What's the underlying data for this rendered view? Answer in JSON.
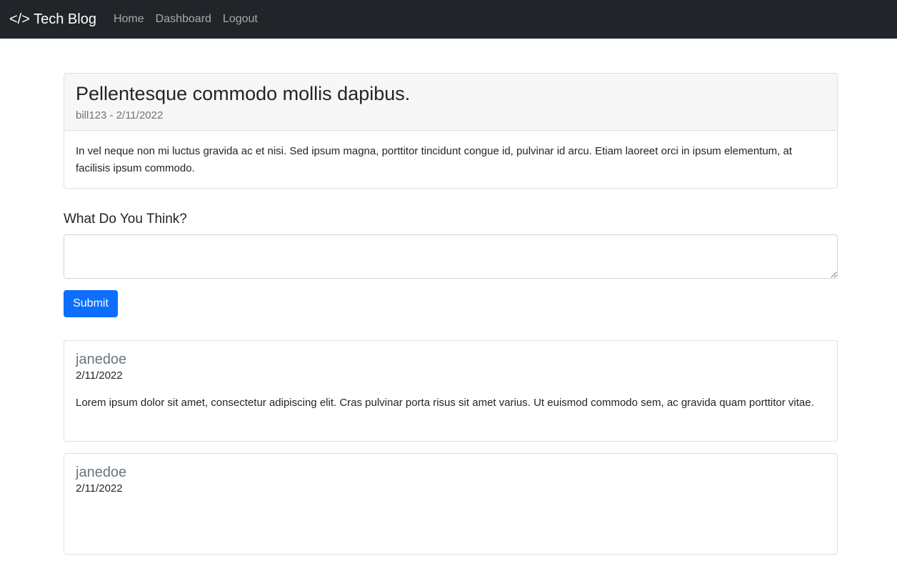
{
  "navbar": {
    "brand": "</> Tech Blog",
    "links": [
      "Home",
      "Dashboard",
      "Logout"
    ]
  },
  "post": {
    "title": "Pellentesque commodo mollis dapibus.",
    "meta": "bill123 - 2/11/2022",
    "body": "In vel neque non mi luctus gravida ac et nisi. Sed ipsum magna, porttitor tincidunt congue id, pulvinar id arcu. Etiam laoreet orci in ipsum elementum, at facilisis ipsum commodo."
  },
  "comment_form": {
    "label": "What Do You Think?",
    "value": "",
    "submit_label": "Submit"
  },
  "comments": [
    {
      "author": "janedoe",
      "date": "2/11/2022",
      "text": "Lorem ipsum dolor sit amet, consectetur adipiscing elit. Cras pulvinar porta risus sit amet varius. Ut euismod commodo sem, ac gravida quam porttitor vitae."
    },
    {
      "author": "janedoe",
      "date": "2/11/2022",
      "text": ""
    }
  ],
  "colors": {
    "navbar_bg": "#212529",
    "primary": "#0d6efd",
    "muted": "#6c757d"
  }
}
